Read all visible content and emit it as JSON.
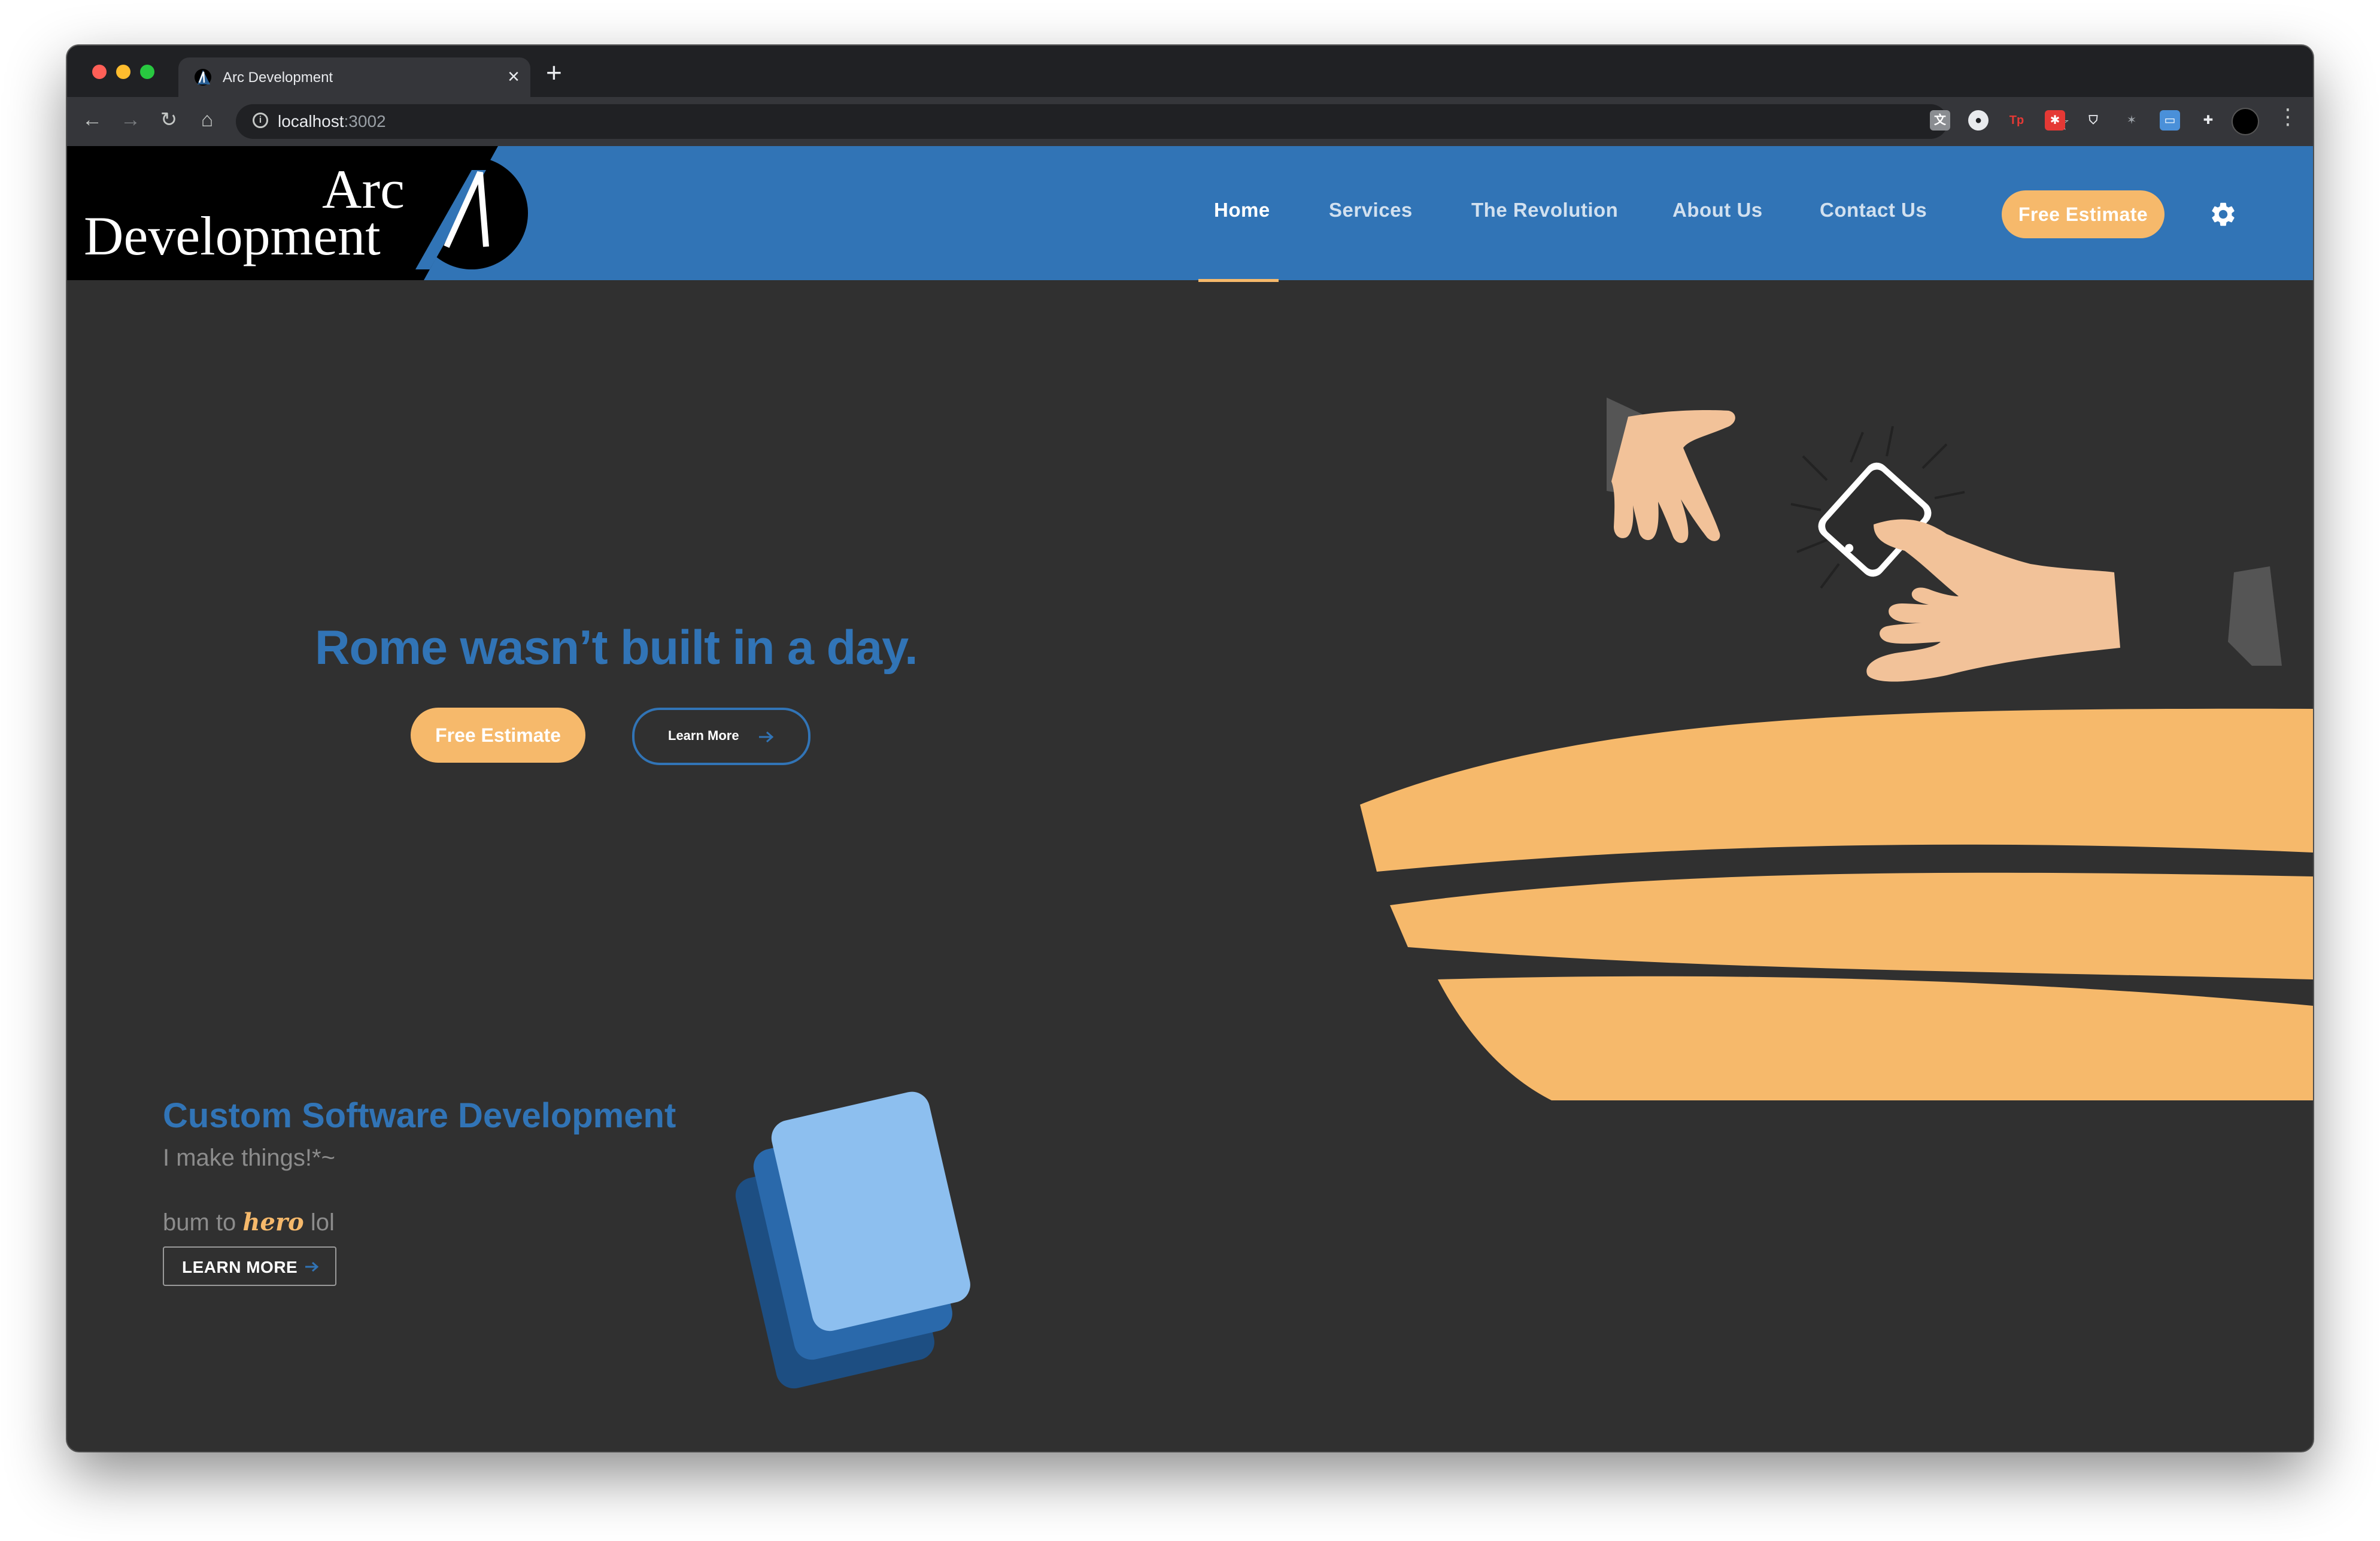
{
  "browser": {
    "tab_title": "Arc Development",
    "tab_close": "×",
    "new_tab": "+",
    "url_host": "localhost",
    "url_port": ":3002"
  },
  "header": {
    "logo_line1": "Arc",
    "logo_line2": "Development",
    "nav": [
      "Home",
      "Services",
      "The Revolution",
      "About Us",
      "Contact Us"
    ],
    "active_tab": "Home",
    "estimate_label": "Free Estimate",
    "accent_color": "#3174b6",
    "highlight_color": "#f6b96b"
  },
  "hero": {
    "title": "Rome wasn’t built in a day.",
    "estimate_label": "Free Estimate",
    "learn_label": "Learn More"
  },
  "service": {
    "title": "Custom Software Development",
    "subtitle": "I make things!*~",
    "line_prefix": "bum to ",
    "line_emphasis": "hero",
    "line_suffix": " lol",
    "learn_label": "LEARN MORE"
  }
}
